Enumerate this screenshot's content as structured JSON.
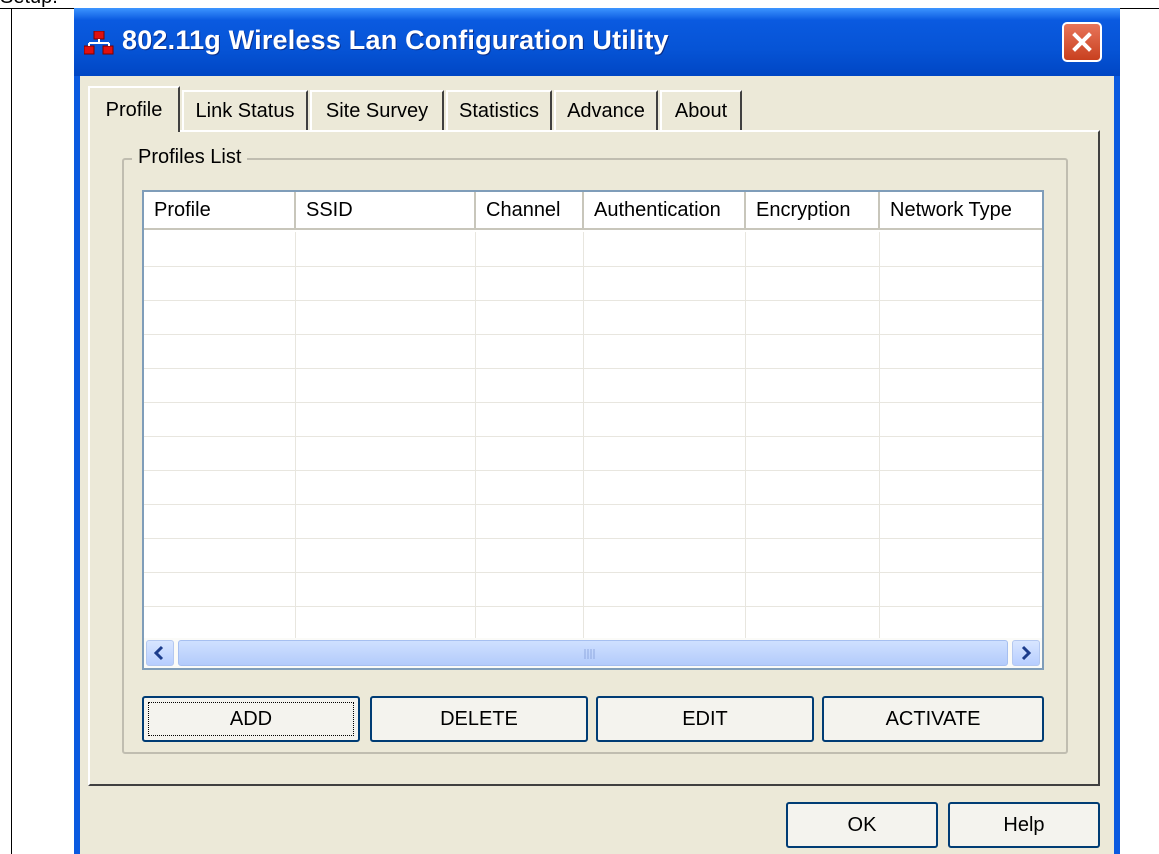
{
  "page": {
    "clipped_text": "Setup."
  },
  "window": {
    "title": "802.11g Wireless Lan Configuration Utility",
    "title_color": "#0a5ae0",
    "close_button_color": "#c8401f"
  },
  "tabs": [
    {
      "label": "Profile",
      "active": true
    },
    {
      "label": "Link Status",
      "active": false
    },
    {
      "label": "Site Survey",
      "active": false
    },
    {
      "label": "Statistics",
      "active": false
    },
    {
      "label": "Advance",
      "active": false
    },
    {
      "label": "About",
      "active": false
    }
  ],
  "profiles_group": {
    "label": "Profiles List",
    "columns": [
      "Profile",
      "SSID",
      "Channel",
      "Authentication",
      "Encryption",
      "Network Type"
    ],
    "rows": []
  },
  "profile_buttons": {
    "add": "ADD",
    "delete": "DELETE",
    "edit": "EDIT",
    "activate": "ACTIVATE"
  },
  "dialog_buttons": {
    "ok": "OK",
    "help": "Help"
  },
  "colors": {
    "client_bg": "#ece9d8",
    "list_border": "#7f9db9",
    "scrollbar": "#b7ceff"
  }
}
